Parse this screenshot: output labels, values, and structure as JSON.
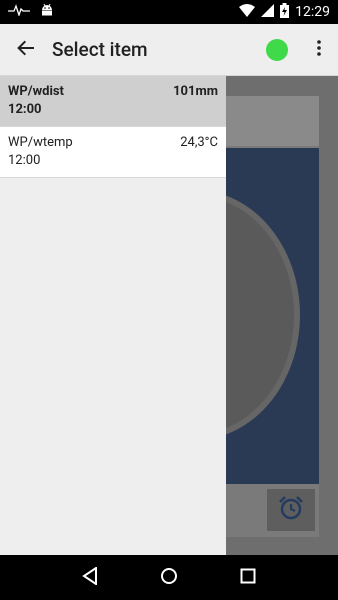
{
  "status_bar": {
    "time": "12:29",
    "icons": [
      "pulse-icon",
      "android-icon",
      "wifi-icon",
      "signal-icon",
      "battery-charging-icon"
    ]
  },
  "toolbar": {
    "title": "Select item",
    "status_color": "#3fd94a",
    "icons": [
      "back-arrow-icon",
      "more-vert-icon"
    ]
  },
  "drawer": {
    "items": [
      {
        "name": "WP/wdist",
        "value": "101mm",
        "time": "12:00",
        "selected": true
      },
      {
        "name": "WP/wtemp",
        "value": "24,3°C",
        "time": "12:00",
        "selected": false
      }
    ]
  },
  "background": {
    "icons": [
      "alarm-clock-icon"
    ]
  },
  "nav_bar": {
    "icons": [
      "back-triangle-icon",
      "home-circle-icon",
      "recents-square-icon"
    ]
  }
}
